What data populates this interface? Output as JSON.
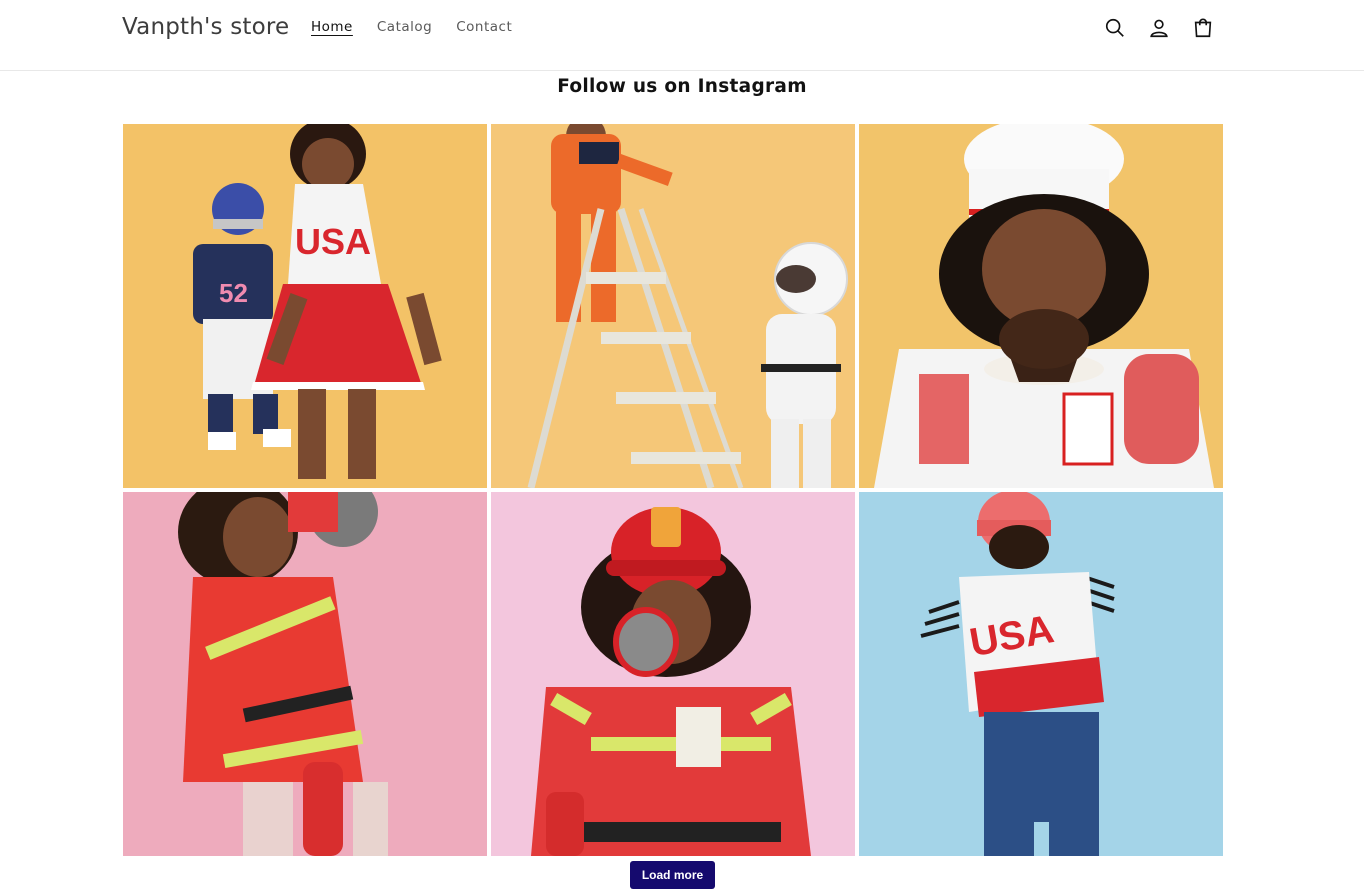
{
  "header": {
    "store_name": "Vanpth's store",
    "nav": [
      {
        "label": "Home",
        "active": true
      },
      {
        "label": "Catalog",
        "active": false
      },
      {
        "label": "Contact",
        "active": false
      }
    ],
    "icons": [
      "search-icon",
      "account-icon",
      "cart-icon"
    ]
  },
  "instagram": {
    "title": "Follow us on Instagram",
    "photos": [
      {
        "subject": "kids-in-football-and-cheerleader-costumes",
        "bg": "#f3c267"
      },
      {
        "subject": "kids-in-astronaut-costumes-with-ladder",
        "bg": "#f5c778"
      },
      {
        "subject": "kid-in-chef-costume-with-cupcake",
        "bg": "#f2c46a"
      },
      {
        "subject": "kid-in-firefighter-costume-with-megaphone",
        "bg": "#eeabbd"
      },
      {
        "subject": "kid-in-firefighter-helmet-with-megaphone",
        "bg": "#f3c6dd"
      },
      {
        "subject": "kid-in-usa-jersey-and-pink-beanie",
        "bg": "#a4d4e8"
      }
    ],
    "load_more_label": "Load more"
  },
  "colors": {
    "button_bg": "#150a6e",
    "divider": "#e8e8e8"
  }
}
